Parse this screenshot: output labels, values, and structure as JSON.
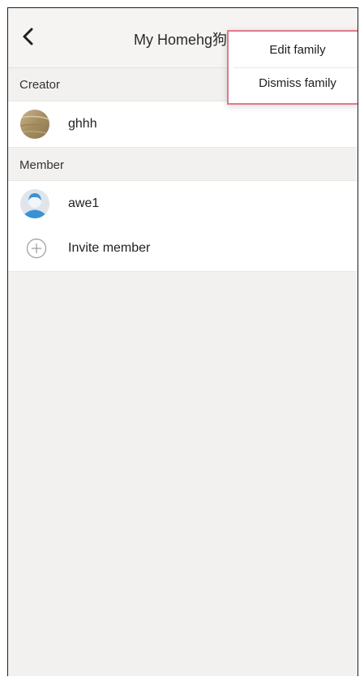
{
  "header": {
    "title": "My Homehg狗",
    "back_icon": "chevron-left-icon"
  },
  "sections": {
    "creator_label": "Creator",
    "member_label": "Member"
  },
  "creator": {
    "name": "ghhh",
    "avatar": "photo-avatar"
  },
  "member": {
    "name": "awe1",
    "avatar": "default-user-avatar"
  },
  "invite": {
    "label": "Invite member",
    "icon": "plus-circle-icon"
  },
  "menu": {
    "items": [
      {
        "label": "Edit family"
      },
      {
        "label": "Dismiss family"
      }
    ],
    "border_color": "#e07a8a"
  }
}
